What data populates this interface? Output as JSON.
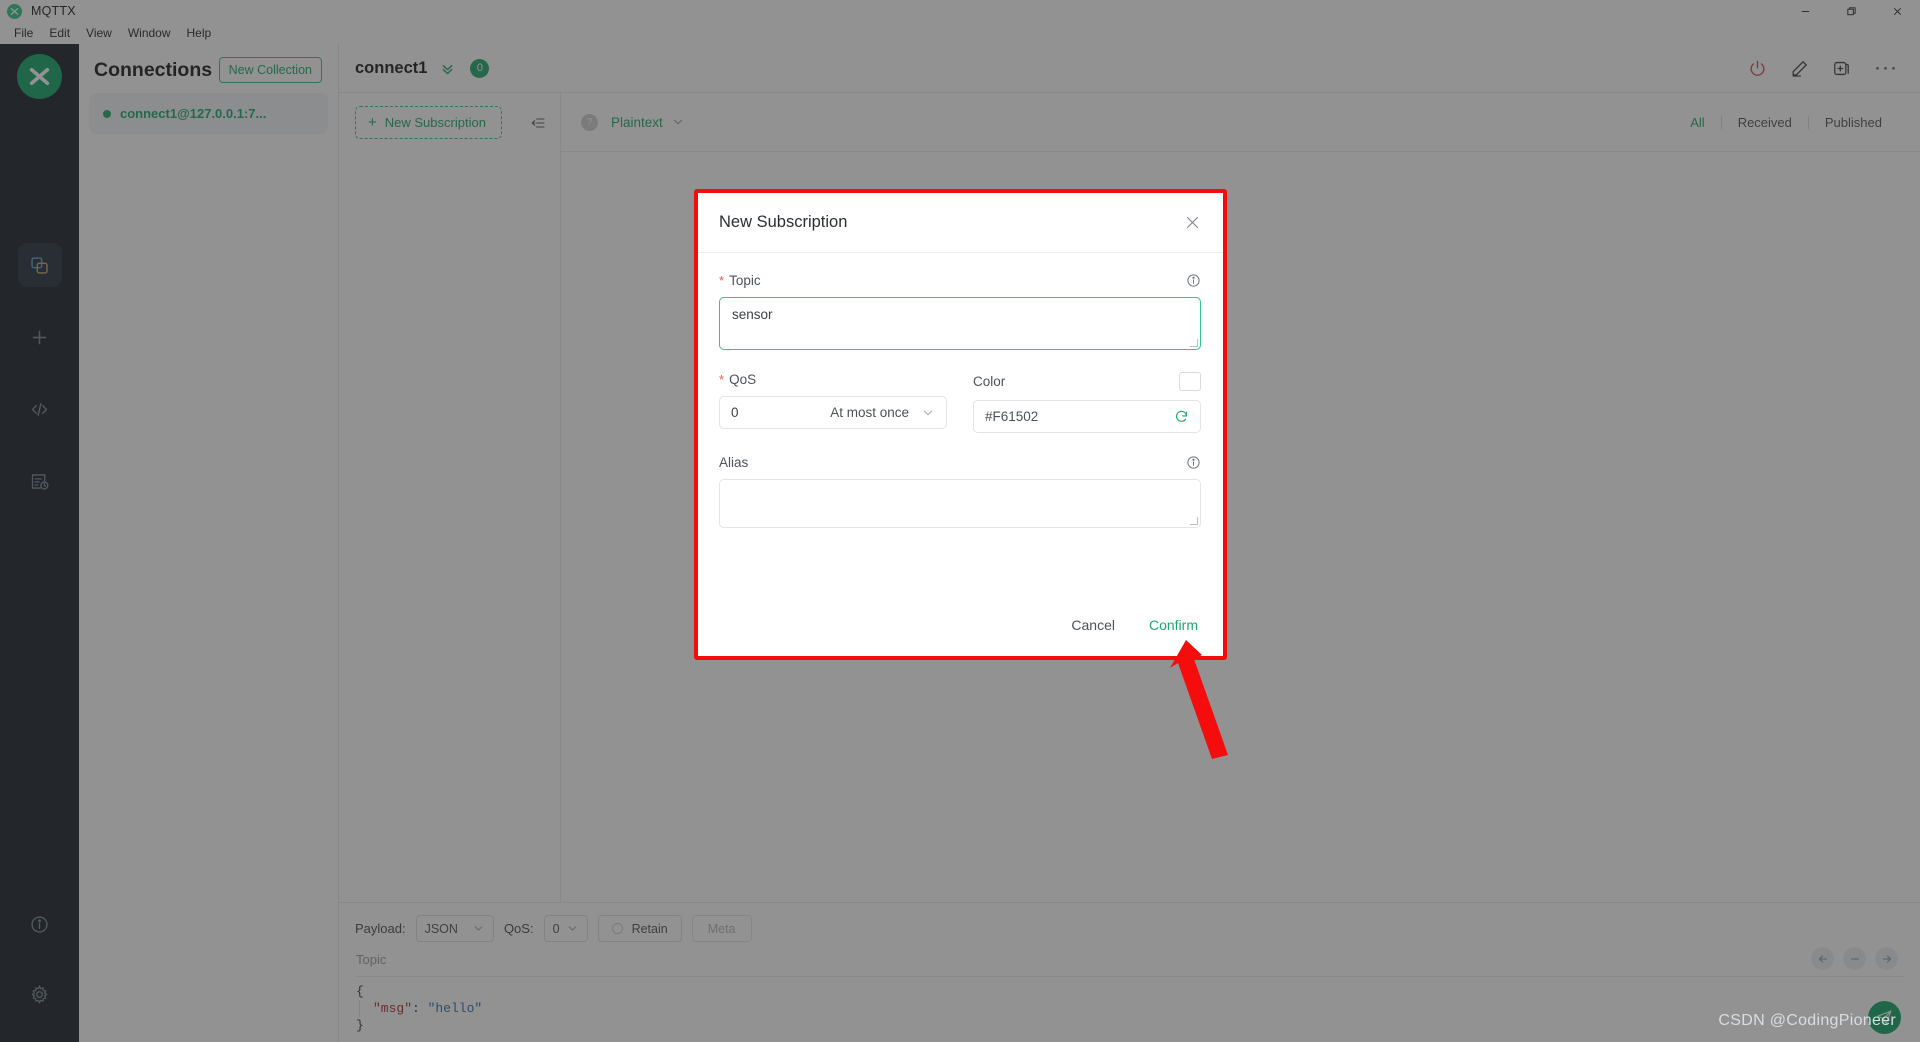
{
  "titlebar": {
    "app_title": "MQTTX",
    "logo_icon": "mqttx-logo-icon",
    "minimize_icon": "minimize-icon",
    "maximize_icon": "maximize-icon",
    "close_icon": "close-icon"
  },
  "menubar": {
    "items": [
      {
        "label": "File"
      },
      {
        "label": "Edit"
      },
      {
        "label": "View"
      },
      {
        "label": "Window"
      },
      {
        "label": "Help"
      }
    ]
  },
  "rail": {
    "logo_icon": "mqttx-logo-icon",
    "items": [
      {
        "icon": "connections-icon",
        "active": true
      },
      {
        "icon": "plus-icon",
        "active": false
      },
      {
        "icon": "code-brackets-icon",
        "active": false
      },
      {
        "icon": "script-log-icon",
        "active": false
      }
    ],
    "bottom_items": [
      {
        "icon": "info-circle-icon"
      },
      {
        "icon": "gear-icon"
      }
    ]
  },
  "connections": {
    "title": "Connections",
    "new_collection_label": "New Collection",
    "items": [
      {
        "label": "connect1@127.0.0.1:7...",
        "status": "connected"
      }
    ]
  },
  "main": {
    "header": {
      "title": "connect1",
      "chevron_icon": "double-chevron-down-icon",
      "badge_count": "0",
      "actions": [
        {
          "icon": "power-icon"
        },
        {
          "icon": "edit-pencil-icon"
        },
        {
          "icon": "new-window-icon"
        },
        {
          "icon": "more-dots-icon"
        }
      ]
    },
    "subscriptions": {
      "new_subscription_label": "New Subscription",
      "plus_icon": "plus-icon",
      "collapse_icon": "collapse-panel-icon"
    },
    "toolbar": {
      "help_icon": "question-mark-icon",
      "format_label": "Plaintext",
      "format_chevron_icon": "chevron-down-icon",
      "filters": [
        {
          "label": "All",
          "active": true
        },
        {
          "label": "Received",
          "active": false
        },
        {
          "label": "Published",
          "active": false
        }
      ]
    }
  },
  "publish": {
    "payload_label": "Payload:",
    "payload_value": "JSON",
    "qos_label": "QoS:",
    "qos_value": "0",
    "retain_label": "Retain",
    "meta_label": "Meta",
    "topic_placeholder": "Topic",
    "topic_chevron_icon": "chevron-down-icon",
    "code": {
      "line1": "{",
      "key": "\"msg\"",
      "colon": ": ",
      "value": "\"hello\"",
      "line3": "}"
    },
    "controls": [
      {
        "icon": "arrow-left-icon"
      },
      {
        "icon": "minus-icon"
      },
      {
        "icon": "arrow-right-icon"
      }
    ],
    "send_icon": "send-paper-plane-icon"
  },
  "dialog": {
    "title": "New Subscription",
    "close_icon": "close-icon",
    "topic": {
      "label": "Topic",
      "required": "*",
      "value": "sensor",
      "info_icon": "info-circle-icon"
    },
    "qos": {
      "label": "QoS",
      "required": "*",
      "value": "0",
      "text": "At most once",
      "chevron_icon": "chevron-down-icon"
    },
    "color": {
      "label": "Color",
      "value": "#F61502",
      "swatch_hex": "#F61502",
      "refresh_icon": "refresh-icon",
      "swatch_icon": "color-swatch-icon"
    },
    "alias": {
      "label": "Alias",
      "value": "",
      "info_icon": "info-circle-icon"
    },
    "cancel_label": "Cancel",
    "confirm_label": "Confirm",
    "highlight_color": "#F50D0D"
  },
  "annotation": {
    "arrow_icon": "red-arrow-icon",
    "arrow_color": "#F50D0D"
  },
  "watermark": {
    "text": "CSDN @CodingPioneer"
  }
}
